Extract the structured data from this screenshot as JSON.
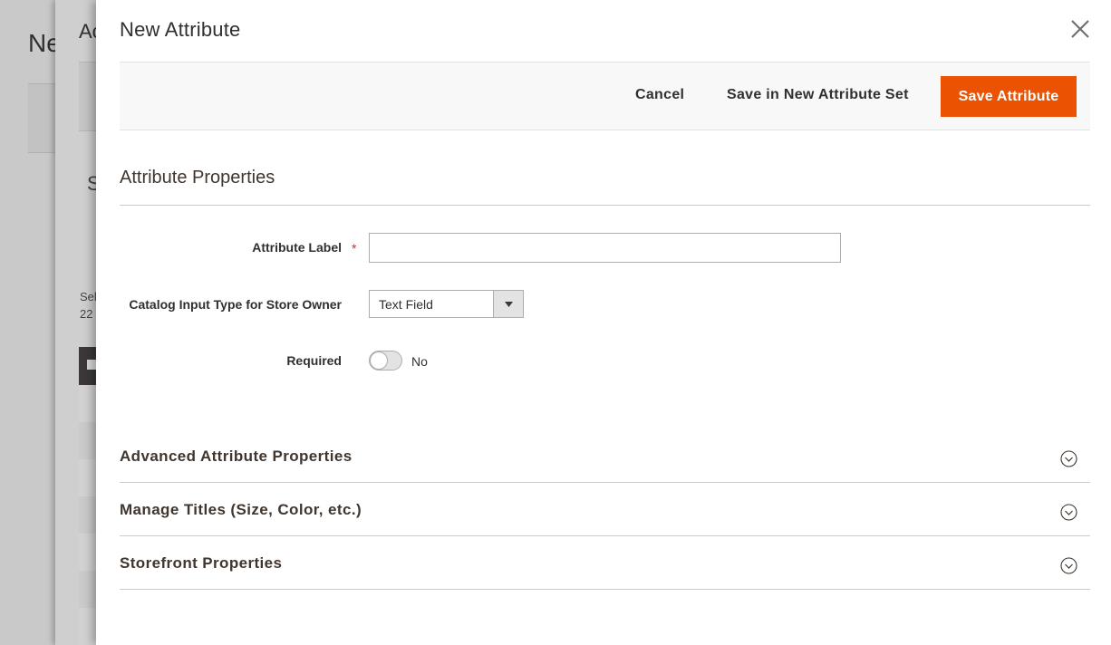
{
  "background": {
    "page_title_fragment": "Ne",
    "panel_title_fragment": "Ac",
    "panel_heading_fragment": "S",
    "panel_text_line1": "Sel",
    "panel_text_line2": "22"
  },
  "modal": {
    "title": "New Attribute"
  },
  "toolbar": {
    "cancel_label": "Cancel",
    "save_new_set_label": "Save in New Attribute Set",
    "save_attribute_label": "Save Attribute"
  },
  "section": {
    "title": "Attribute Properties"
  },
  "fields": {
    "attribute_label": {
      "label": "Attribute Label",
      "required_marker": "*",
      "value": ""
    },
    "input_type": {
      "label": "Catalog Input Type for Store Owner",
      "selected": "Text Field"
    },
    "required": {
      "label": "Required",
      "state_text": "No",
      "checked": false
    }
  },
  "collapsibles": [
    {
      "title": "Advanced Attribute Properties",
      "icon": "chevron-down-circle-icon"
    },
    {
      "title": "Manage Titles (Size, Color, etc.)",
      "icon": "chevron-down-circle-icon"
    },
    {
      "title": "Storefront Properties",
      "icon": "chevron-down-circle-icon"
    }
  ],
  "colors": {
    "primary_button": "#eb5202",
    "toolbar_bg": "#f8f8f8",
    "overlay": "#c9c9c9"
  }
}
